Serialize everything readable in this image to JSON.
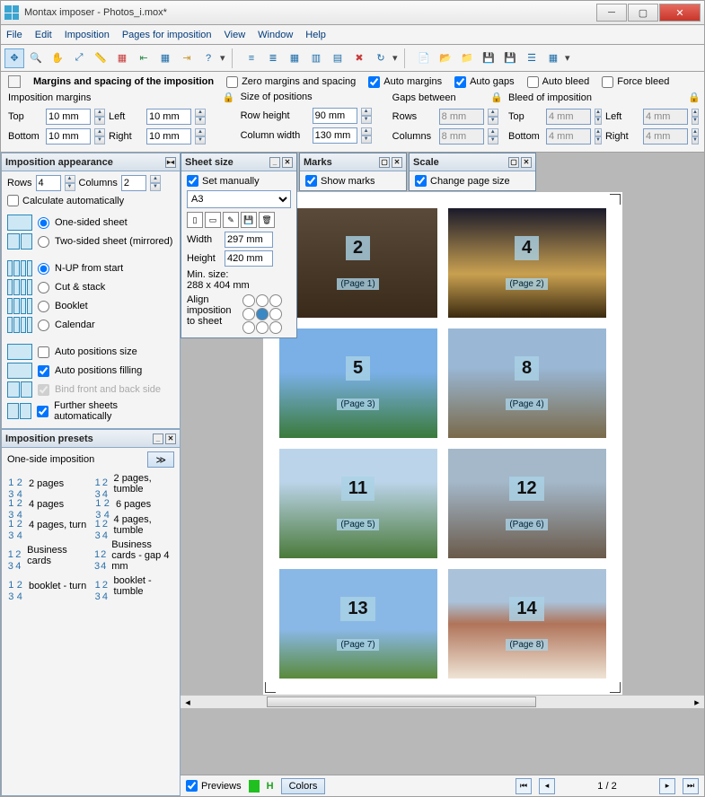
{
  "window": {
    "title": "Montax imposer - Photos_i.mox*"
  },
  "menu": [
    "File",
    "Edit",
    "Imposition",
    "Pages for imposition",
    "View",
    "Window",
    "Help"
  ],
  "margins_panel": {
    "heading": "Margins and spacing of the imposition",
    "zero": "Zero margins and spacing",
    "auto_margins": "Auto margins",
    "auto_gaps": "Auto gaps",
    "auto_bleed": "Auto bleed",
    "force_bleed": "Force bleed",
    "imposition_margins_label": "Imposition margins",
    "top_label": "Top",
    "top": "10 mm",
    "bottom_label": "Bottom",
    "bottom": "10 mm",
    "left_label": "Left",
    "left": "10 mm",
    "right_label": "Right",
    "right": "10 mm",
    "size_label": "Size of positions",
    "row_h_label": "Row height",
    "row_h": "90 mm",
    "col_w_label": "Column width",
    "col_w": "130 mm",
    "gaps_label": "Gaps between",
    "gaps_rows_label": "Rows",
    "gaps_rows": "8 mm",
    "gaps_cols_label": "Columns",
    "gaps_cols": "8 mm",
    "bleed_label": "Bleed of imposition",
    "bleed_top": "4 mm",
    "bleed_left": "4 mm",
    "bleed_bottom": "4 mm",
    "bleed_right": "4 mm"
  },
  "appearance": {
    "title": "Imposition appearance",
    "rows_label": "Rows",
    "rows": "4",
    "cols_label": "Columns",
    "cols": "2",
    "calc_auto": "Calculate automatically",
    "one_sided": "One-sided sheet",
    "two_sided": "Two-sided sheet (mirrored)",
    "nup": "N-UP from start",
    "cutstack": "Cut & stack",
    "booklet": "Booklet",
    "calendar": "Calendar",
    "auto_pos_size": "Auto positions size",
    "auto_pos_fill": "Auto positions filling",
    "bind_front": "Bind front and back side",
    "further": "Further sheets automatically"
  },
  "presets": {
    "title": "Imposition presets",
    "current": "One-side imposition",
    "items": [
      [
        "2 pages",
        "2 pages, tumble"
      ],
      [
        "4 pages",
        "6 pages"
      ],
      [
        "4 pages, turn",
        "4 pages, tumble"
      ],
      [
        "Business cards",
        "Business cards - gap 4 mm"
      ],
      [
        "booklet - turn",
        "booklet - tumble"
      ]
    ]
  },
  "sheet": {
    "title": "Sheet size",
    "set_manually": "Set manually",
    "format": "A3",
    "width_label": "Width",
    "width": "297 mm",
    "height_label": "Height",
    "height": "420 mm",
    "min_label": "Min. size:",
    "min_value": "288 x 404 mm",
    "align_label": "Align imposition to sheet"
  },
  "marks": {
    "title": "Marks",
    "show": "Show marks"
  },
  "scale": {
    "title": "Scale",
    "change": "Change page size"
  },
  "cells": [
    {
      "num": "2",
      "page": "(Page 1)"
    },
    {
      "num": "4",
      "page": "(Page 2)"
    },
    {
      "num": "5",
      "page": "(Page 3)"
    },
    {
      "num": "8",
      "page": "(Page 4)"
    },
    {
      "num": "11",
      "page": "(Page 5)"
    },
    {
      "num": "12",
      "page": "(Page 6)"
    },
    {
      "num": "13",
      "page": "(Page 7)"
    },
    {
      "num": "14",
      "page": "(Page 8)"
    }
  ],
  "footer": {
    "previews": "Previews",
    "colors": "Colors",
    "page_indicator": "1 / 2"
  }
}
